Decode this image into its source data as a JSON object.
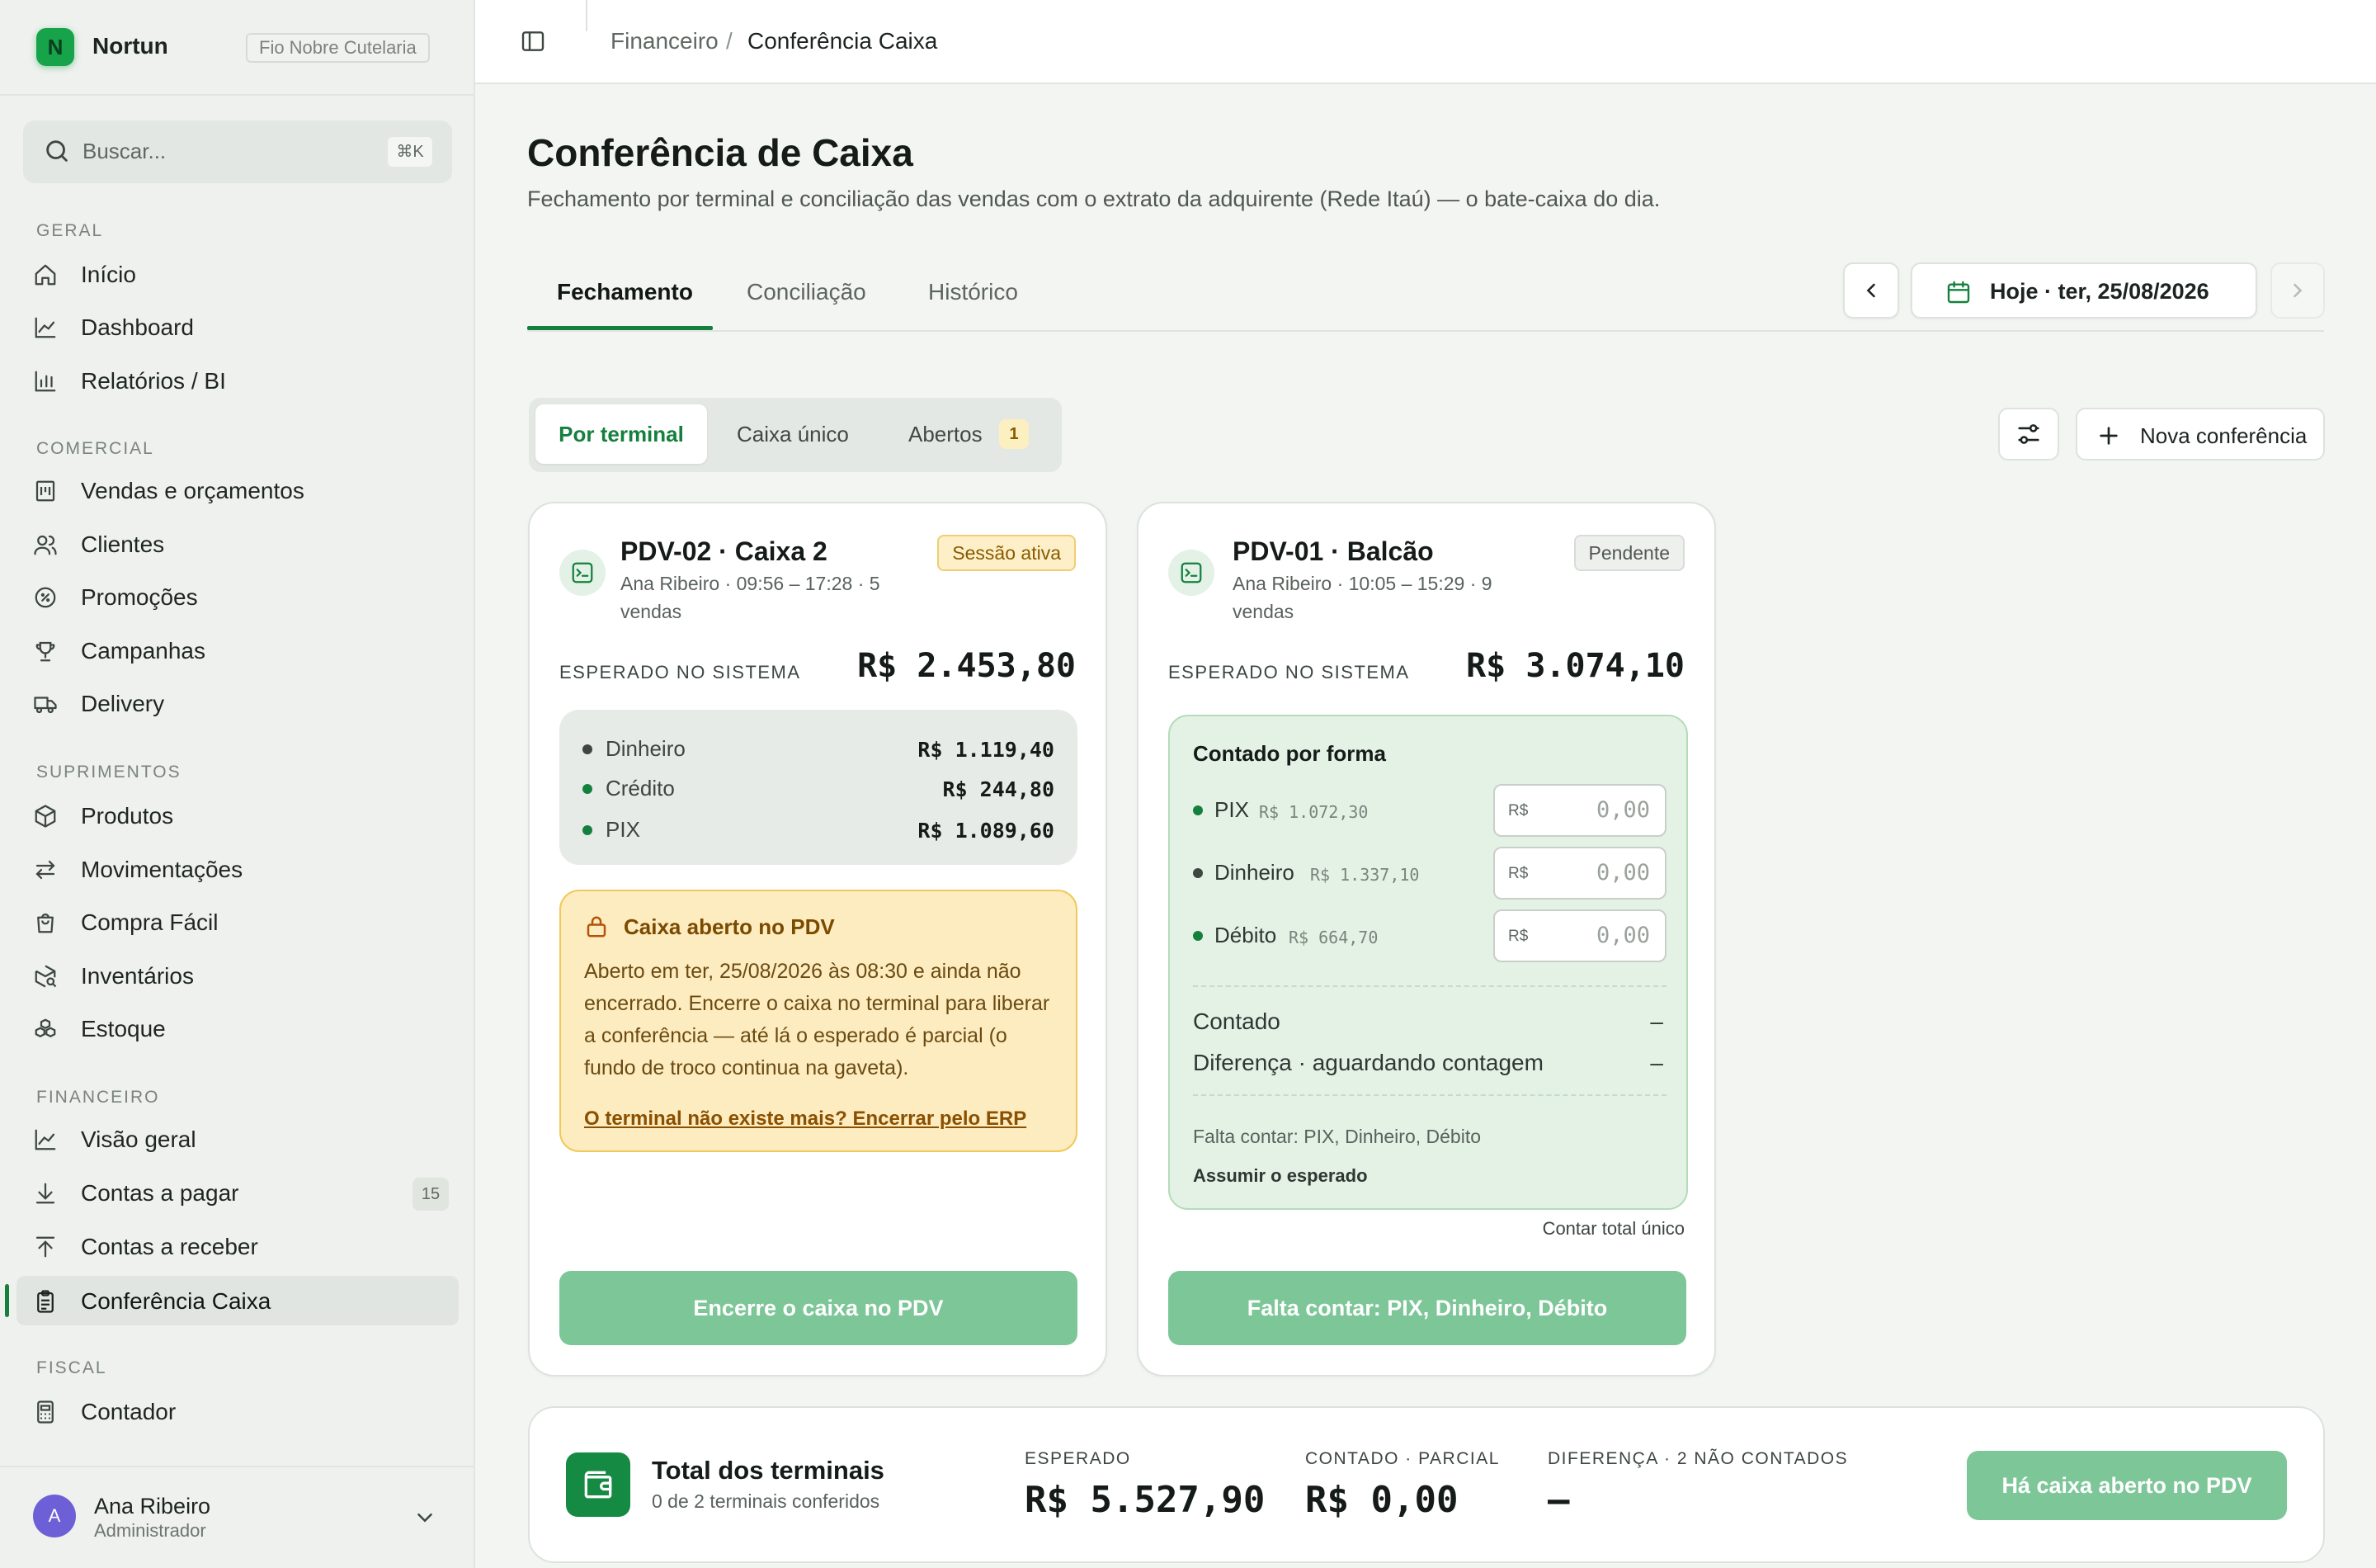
{
  "brand": {
    "logo_letter": "N",
    "name": "Nortun",
    "tenant": "Fio Nobre Cutelaria"
  },
  "search": {
    "placeholder": "Buscar...",
    "shortcut": "⌘K"
  },
  "sidebar": {
    "sections": {
      "geral": "GERAL",
      "comercial": "COMERCIAL",
      "suprimentos": "SUPRIMENTOS",
      "financeiro": "FINANCEIRO",
      "fiscal": "FISCAL"
    },
    "items": [
      {
        "label": "Início",
        "icon": "home-icon"
      },
      {
        "label": "Dashboard",
        "icon": "line-chart-icon"
      },
      {
        "label": "Relatórios / BI",
        "icon": "bar-chart-icon"
      },
      {
        "label": "Vendas e orçamentos",
        "icon": "receipt-icon"
      },
      {
        "label": "Clientes",
        "icon": "users-icon"
      },
      {
        "label": "Promoções",
        "icon": "discount-icon"
      },
      {
        "label": "Campanhas",
        "icon": "trophy-icon"
      },
      {
        "label": "Delivery",
        "icon": "truck-icon"
      },
      {
        "label": "Produtos",
        "icon": "box-icon"
      },
      {
        "label": "Movimentações",
        "icon": "arrows-icon"
      },
      {
        "label": "Compra Fácil",
        "icon": "shopping-bag-icon"
      },
      {
        "label": "Inventários",
        "icon": "box-search-icon"
      },
      {
        "label": "Estoque",
        "icon": "boxes-icon"
      },
      {
        "label": "Visão geral",
        "icon": "line-chart-icon"
      },
      {
        "label": "Contas a pagar",
        "icon": "download-icon",
        "badge": "15"
      },
      {
        "label": "Contas a receber",
        "icon": "upload-icon"
      },
      {
        "label": "Conferência Caixa",
        "icon": "clipboard-icon",
        "active": true
      },
      {
        "label": "Contador",
        "icon": "calculator-icon"
      }
    ]
  },
  "user": {
    "initial": "A",
    "name": "Ana Ribeiro",
    "role": "Administrador"
  },
  "breadcrumb": {
    "parent": "Financeiro",
    "separator": "/",
    "current": "Conferência Caixa"
  },
  "page": {
    "title": "Conferência de Caixa",
    "subtitle": "Fechamento por terminal e conciliação das vendas com o extrato da adquirente (Rede Itaú) — o bate-caixa do dia."
  },
  "tabs": [
    "Fechamento",
    "Conciliação",
    "Histórico"
  ],
  "date_nav": {
    "label": "Hoje · ter, 25/08/2026"
  },
  "segmented": {
    "items": [
      "Por terminal",
      "Caixa único",
      "Abertos"
    ],
    "open_count": "1"
  },
  "actions": {
    "new_label": "Nova conferência"
  },
  "terminals": [
    {
      "title": "PDV-02 · Caixa 2",
      "meta": "Ana Ribeiro · 09:56 – 17:28 · 5 vendas",
      "status": "Sessão ativa",
      "expected_label": "ESPERADO NO SISTEMA",
      "expected_value": "R$ 2.453,80",
      "payments": [
        {
          "label": "Dinheiro",
          "value": "R$ 1.119,40"
        },
        {
          "label": "Crédito",
          "value": "R$ 244,80"
        },
        {
          "label": "PIX",
          "value": "R$ 1.089,60"
        }
      ],
      "alert": {
        "title": "Caixa aberto no PDV",
        "body": "Aberto em ter, 25/08/2026 às 08:30 e ainda não encerrado. Encerre o caixa no terminal para liberar a conferência — até lá o esperado é parcial (o fundo de troco continua na gaveta).",
        "link": "O terminal não existe mais? Encerrar pelo ERP"
      },
      "button": "Encerre o caixa no PDV"
    },
    {
      "title": "PDV-01 · Balcão",
      "meta": "Ana Ribeiro · 10:05 – 15:29 · 9 vendas",
      "status": "Pendente",
      "expected_label": "ESPERADO NO SISTEMA",
      "expected_value": "R$ 3.074,10",
      "count": {
        "title": "Contado por forma",
        "rows": [
          {
            "label": "PIX",
            "expected": "R$ 1.072,30",
            "currency": "R$",
            "value": "0,00"
          },
          {
            "label": "Dinheiro",
            "expected": "R$ 1.337,10",
            "currency": "R$",
            "value": "0,00"
          },
          {
            "label": "Débito",
            "expected": "R$ 664,70",
            "currency": "R$",
            "value": "0,00"
          }
        ],
        "counted_label": "Contado",
        "counted_value": "–",
        "diff_label": "Diferença · aguardando contagem",
        "diff_value": "–",
        "missing": "Falta contar: PIX, Dinheiro, Débito",
        "assume": "Assumir o esperado"
      },
      "single_total_link": "Contar total único",
      "button": "Falta contar: PIX, Dinheiro, Débito"
    }
  ],
  "totals": {
    "title": "Total dos terminais",
    "subtitle": "0 de 2 terminais conferidos",
    "expected_label": "ESPERADO",
    "expected_value": "R$ 5.527,90",
    "counted_label": "CONTADO · PARCIAL",
    "counted_value": "R$ 0,00",
    "diff_label": "DIFERENÇA · 2 NÃO CONTADOS",
    "diff_value": "–",
    "button": "Há caixa aberto no PDV"
  },
  "colors": {
    "accent": "#15803d",
    "accent_soft": "#7dc698",
    "warning_bg": "#fdecbf",
    "warning_border": "#f1c95b"
  }
}
